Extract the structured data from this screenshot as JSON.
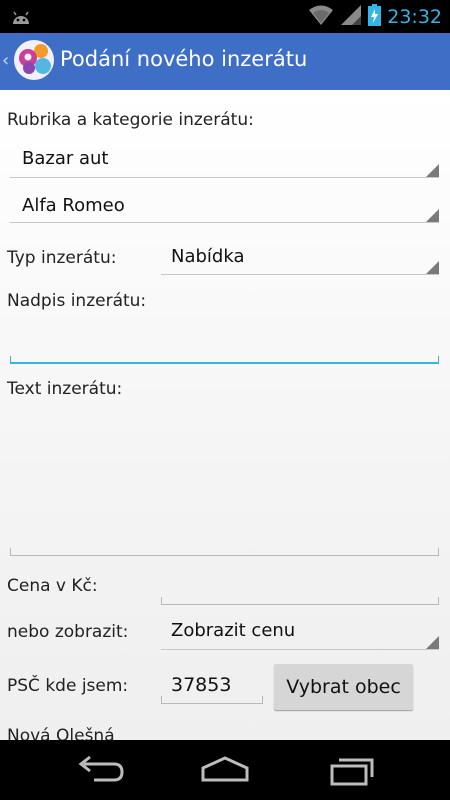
{
  "status_bar": {
    "time": "23:32",
    "icons": [
      "android-debug-icon",
      "wifi-icon",
      "signal-icon",
      "battery-charging-icon"
    ]
  },
  "action_bar": {
    "title": "Podání nového inzerátu",
    "app_icon": "app-logo-icon"
  },
  "form": {
    "category_label": "Rubrika a kategorie inzerátu:",
    "rubric_value": "Bazar aut",
    "category_value": "Alfa Romeo",
    "type_label": "Typ inzerátu:",
    "type_value": "Nabídka",
    "headline_label": "Nadpis inzerátu:",
    "headline_value": "",
    "text_label": "Text inzerátu:",
    "text_value": "",
    "price_label": "Cena v Kč:",
    "price_value": "",
    "display_label": "nebo zobrazit:",
    "display_value": "Zobrazit cenu",
    "zip_label": "PSČ kde jsem:",
    "zip_value": "37853",
    "choose_town_button": "Vybrat obec",
    "town_value": "Nová Olešná"
  },
  "nav_bar": {
    "icons": [
      "back-icon",
      "home-icon",
      "recent-apps-icon"
    ]
  },
  "colors": {
    "action_bar": "#3f6ec6",
    "accent": "#33b5e5",
    "status_bar": "#000000"
  }
}
